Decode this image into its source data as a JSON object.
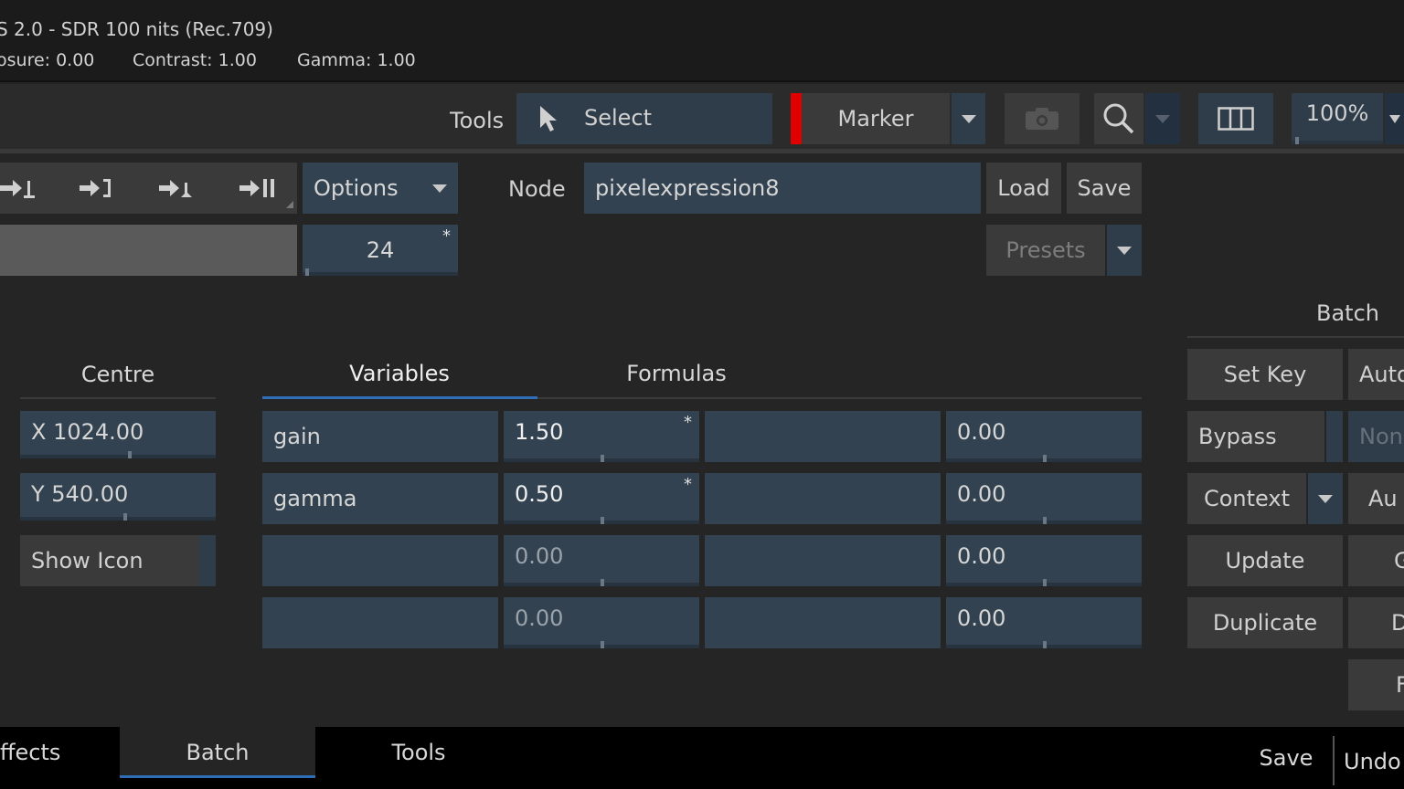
{
  "info": {
    "display": "S 2.0 - SDR 100 nits (Rec.709)",
    "exposure": "osure: 0.00",
    "contrast": "Contrast: 1.00",
    "gamma": "Gamma: 1.00"
  },
  "toolbar": {
    "tools_label": "Tools",
    "select_label": "Select",
    "marker_label": "Marker",
    "zoom_label": "100%"
  },
  "transport": {
    "options_label": "Options",
    "frame_value": "24",
    "frame_star": "*"
  },
  "node": {
    "label": "Node",
    "value": "pixelexpression8",
    "load_label": "Load",
    "save_label": "Save",
    "presets_label": "Presets"
  },
  "centre": {
    "title": "Centre",
    "x": "X 1024.00",
    "y": "Y 540.00",
    "show_icon": "Show Icon"
  },
  "tabs": {
    "variables": "Variables",
    "formulas": "Formulas"
  },
  "variables": [
    {
      "name": "gain",
      "value": "1.50",
      "star": "*",
      "extra": "",
      "value2": "0.00"
    },
    {
      "name": "gamma",
      "value": "0.50",
      "star": "*",
      "extra": "",
      "value2": "0.00"
    },
    {
      "name": "",
      "value": "0.00",
      "star": "",
      "extra": "",
      "value2": "0.00"
    },
    {
      "name": "",
      "value": "0.00",
      "star": "",
      "extra": "",
      "value2": "0.00"
    }
  ],
  "batch": {
    "title": "Batch",
    "set_key": "Set Key",
    "auto": "Auto",
    "bypass": "Bypass",
    "none": "None",
    "context": "Context",
    "au": "Au (",
    "update": "Update",
    "g": "G",
    "duplicate": "Duplicate",
    "d": "D",
    "f": "F"
  },
  "bottom": {
    "effects": "ffects",
    "batch": "Batch",
    "tools": "Tools",
    "save": "Save",
    "undo": "Undo"
  }
}
